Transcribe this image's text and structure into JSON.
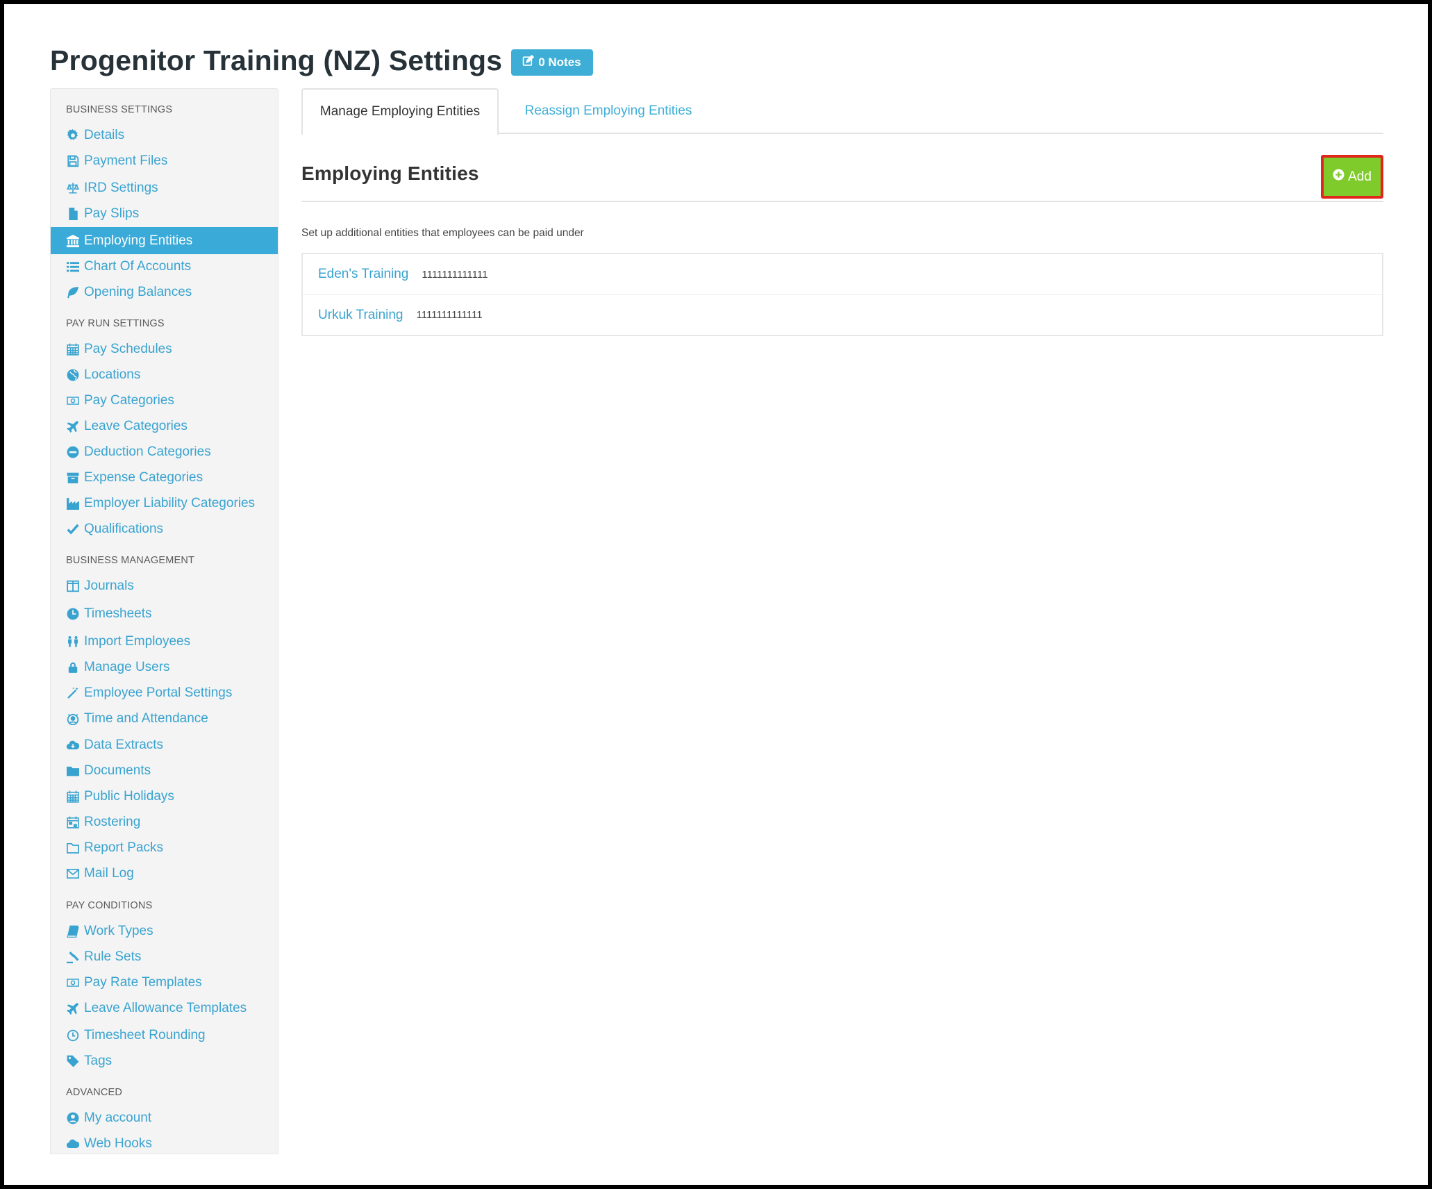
{
  "header": {
    "title": "Progenitor Training (NZ) Settings",
    "notes_label": "0 Notes"
  },
  "sidebar": {
    "sections": [
      {
        "heading": "BUSINESS SETTINGS",
        "items": [
          {
            "label": "Details",
            "icon": "gear-icon"
          },
          {
            "label": "Payment Files",
            "icon": "floppy-disk-icon"
          },
          {
            "label": "IRD Settings",
            "icon": "scales-icon"
          },
          {
            "label": "Pay Slips",
            "icon": "file-icon"
          },
          {
            "label": "Employing Entities",
            "icon": "bank-icon",
            "active": true
          },
          {
            "label": "Chart Of Accounts",
            "icon": "list-icon"
          },
          {
            "label": "Opening Balances",
            "icon": "leaf-icon"
          }
        ]
      },
      {
        "heading": "PAY RUN SETTINGS",
        "items": [
          {
            "label": "Pay Schedules",
            "icon": "calendar-icon"
          },
          {
            "label": "Locations",
            "icon": "globe-icon"
          },
          {
            "label": "Pay Categories",
            "icon": "money-icon"
          },
          {
            "label": "Leave Categories",
            "icon": "plane-icon"
          },
          {
            "label": "Deduction Categories",
            "icon": "minus-circle-icon"
          },
          {
            "label": "Expense Categories",
            "icon": "archive-icon"
          },
          {
            "label": "Employer Liability Categories",
            "icon": "industry-icon"
          },
          {
            "label": "Qualifications",
            "icon": "check-icon"
          }
        ]
      },
      {
        "heading": "BUSINESS MANAGEMENT",
        "items": [
          {
            "label": "Journals",
            "icon": "columns-icon"
          },
          {
            "label": "Timesheets",
            "icon": "clock-pie-icon"
          },
          {
            "label": "Import Employees",
            "icon": "people-icon"
          },
          {
            "label": "Manage Users",
            "icon": "lock-icon"
          },
          {
            "label": "Employee Portal Settings",
            "icon": "magic-wand-icon"
          },
          {
            "label": "Time and Attendance",
            "icon": "user-clock-icon"
          },
          {
            "label": "Data Extracts",
            "icon": "cloud-download-icon"
          },
          {
            "label": "Documents",
            "icon": "folder-icon"
          },
          {
            "label": "Public Holidays",
            "icon": "calendar-icon"
          },
          {
            "label": "Rostering",
            "icon": "calendar-grid-icon"
          },
          {
            "label": "Report Packs",
            "icon": "folder-open-icon"
          },
          {
            "label": "Mail Log",
            "icon": "envelope-icon"
          }
        ]
      },
      {
        "heading": "PAY CONDITIONS",
        "items": [
          {
            "label": "Work Types",
            "icon": "book-icon"
          },
          {
            "label": "Rule Sets",
            "icon": "gavel-icon"
          },
          {
            "label": "Pay Rate Templates",
            "icon": "money-icon"
          },
          {
            "label": "Leave Allowance Templates",
            "icon": "plane-icon"
          },
          {
            "label": "Timesheet Rounding",
            "icon": "clock-icon"
          },
          {
            "label": "Tags",
            "icon": "tag-icon"
          }
        ]
      },
      {
        "heading": "ADVANCED",
        "items": [
          {
            "label": "My account",
            "icon": "user-circle-icon"
          },
          {
            "label": "Web Hooks",
            "icon": "cloud-icon"
          }
        ]
      }
    ]
  },
  "tabs": [
    {
      "label": "Manage Employing Entities",
      "active": true
    },
    {
      "label": "Reassign Employing Entities",
      "active": false
    }
  ],
  "main": {
    "section_title": "Employing Entities",
    "add_label": "Add",
    "helper_text": "Set up additional entities that employees can be paid under",
    "entities": [
      {
        "name": "Eden's Training",
        "number": "1111111111111"
      },
      {
        "name": "Urkuk Training",
        "number": "1111111111111"
      }
    ]
  },
  "colors": {
    "accent": "#3aaad8",
    "link": "#39a3d0",
    "add_button": "#7fcb2c",
    "highlight_border": "#e1261c"
  }
}
